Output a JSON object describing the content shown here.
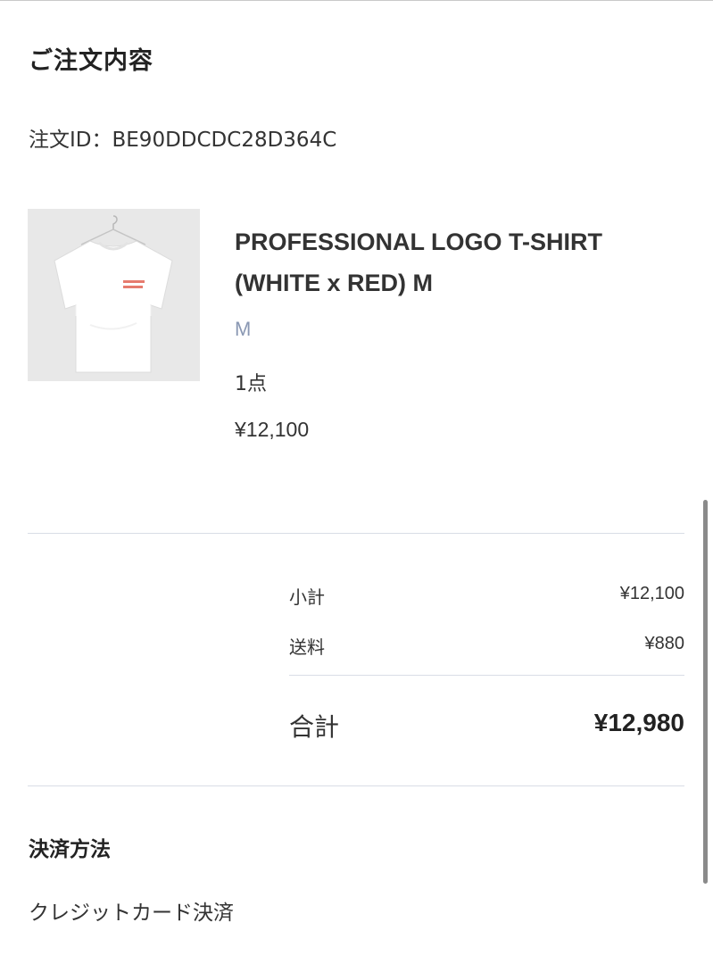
{
  "order_summary": {
    "title": "ご注文内容",
    "order_id_text": "注文ID：BE90DDCDC28D364C"
  },
  "item": {
    "name_line1": "PROFESSIONAL LOGO T-SHIRT",
    "name_line2": "(WHITE x RED) M",
    "variant": "M",
    "quantity": "1点",
    "price": "¥12,100",
    "image_icon": "tshirt-photo",
    "print_color": "#e05a4a"
  },
  "totals": {
    "subtotal_label": "小計",
    "subtotal_value": "¥12,100",
    "shipping_label": "送料",
    "shipping_value": "¥880",
    "total_label": "合計",
    "total_value": "¥12,980"
  },
  "payment": {
    "title": "決済方法",
    "method": "クレジットカード決済"
  },
  "colors": {
    "variant_text": "#8a98b3",
    "divider": "#d9dde6"
  }
}
